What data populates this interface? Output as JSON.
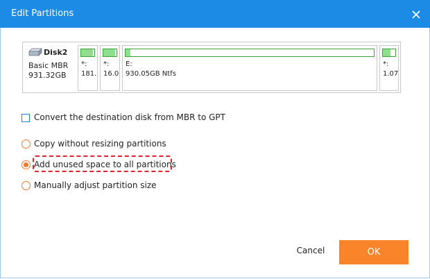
{
  "window": {
    "title": "Edit Partitions",
    "accent": "#1c8be6"
  },
  "disk": {
    "name": "Disk2",
    "type": "Basic MBR",
    "size": "931.32GB",
    "partitions": [
      {
        "label": "*:",
        "size": "181.",
        "used_fraction": 0.9
      },
      {
        "label": "*:",
        "size": "16.0",
        "used_fraction": 0.9
      },
      {
        "label": "E:",
        "size": "930.05GB Ntfs",
        "used_fraction": 0.02
      },
      {
        "label": "*:",
        "size": "1.07",
        "used_fraction": 0.6
      }
    ]
  },
  "options": {
    "convert_gpt": {
      "label": "Convert the destination disk from MBR to GPT",
      "checked": false
    },
    "copy_without_resizing": {
      "label": "Copy without resizing partitions",
      "selected": false
    },
    "add_unused_space": {
      "label": "Add unused space to all partitions",
      "selected": true
    },
    "manually_adjust": {
      "label": "Manually adjust partition size",
      "selected": false
    }
  },
  "buttons": {
    "cancel": "Cancel",
    "ok": "OK",
    "ok_color": "#f9842a"
  }
}
